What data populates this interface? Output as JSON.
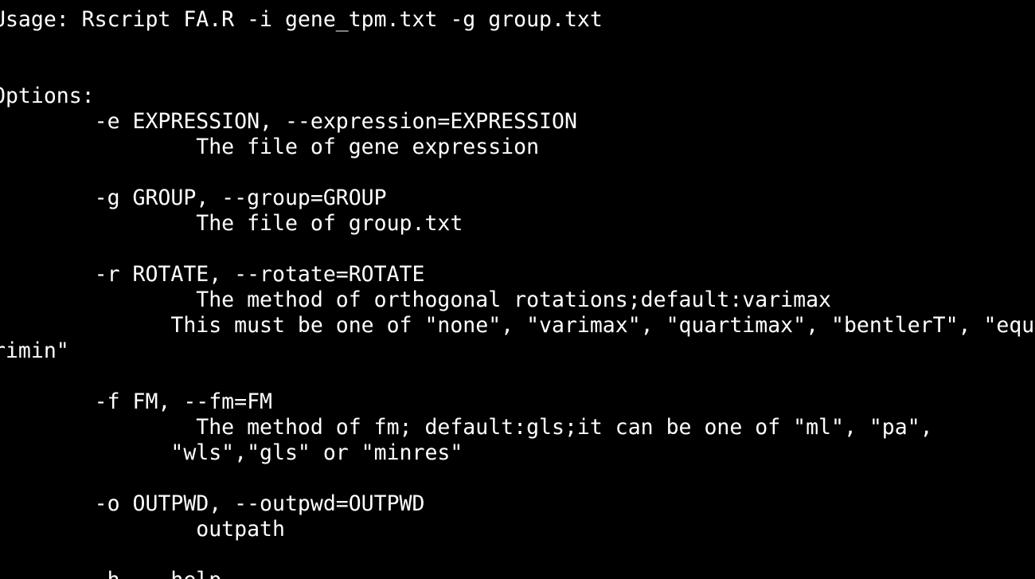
{
  "terminal": {
    "colors": {
      "background": "#000000",
      "foreground": "#ffffff"
    },
    "lines": [
      "Usage: Rscript FA.R -i gene_tpm.txt -g group.txt",
      "",
      "",
      "Options:",
      "        -e EXPRESSION, --expression=EXPRESSION",
      "                The file of gene expression",
      "",
      "        -g GROUP, --group=GROUP",
      "                The file of group.txt",
      "",
      "        -r ROTATE, --rotate=ROTATE",
      "                The method of orthogonal rotations;default:varimax",
      "              This must be one of \"none\", \"varimax\", \"quartimax\", \"bentlerT\", \"equ",
      "rimin\"",
      "",
      "        -f FM, --fm=FM",
      "                The method of fm; default:gls;it can be one of \"ml\", \"pa\",",
      "              \"wls\",\"gls\" or \"minres\"",
      "",
      "        -o OUTPWD, --outpwd=OUTPWD",
      "                outpath",
      "",
      "        -h, --help"
    ]
  }
}
